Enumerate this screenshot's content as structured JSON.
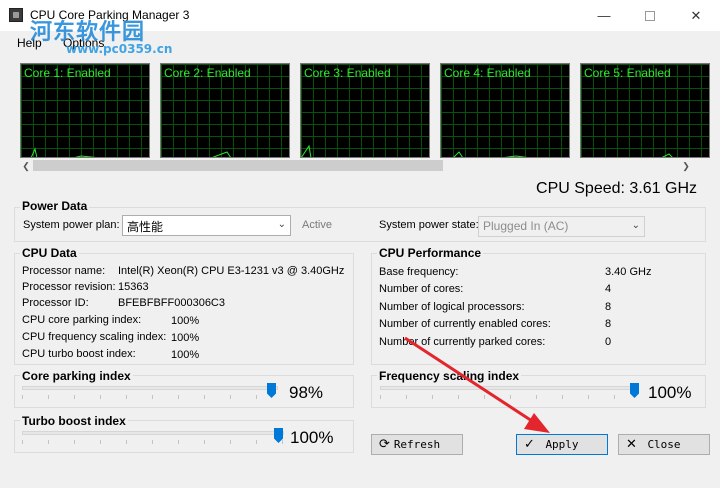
{
  "window": {
    "title": "CPU Core Parking Manager 3"
  },
  "watermark": {
    "text": "河东软件园",
    "url": "www.pc0359.cn"
  },
  "menu": {
    "help": "Help",
    "options": "Options"
  },
  "cores": [
    {
      "label": "Core 1: Enabled"
    },
    {
      "label": "Core 2: Enabled"
    },
    {
      "label": "Core 3: Enabled"
    },
    {
      "label": "Core 4: Enabled"
    },
    {
      "label": "Core 5: Enabled"
    }
  ],
  "cpu_speed": "CPU Speed: 3.61 GHz",
  "power_data": {
    "title": "Power Data",
    "plan_label": "System power plan:",
    "plan_value": "高性能",
    "plan_status": "Active",
    "state_label": "System power state:",
    "state_value": "Plugged In (AC)"
  },
  "cpu_data": {
    "title": "CPU Data",
    "rows": [
      {
        "label": "Processor name:",
        "value": "Intel(R) Xeon(R) CPU E3-1231 v3 @ 3.40GHz"
      },
      {
        "label": "Processor revision:",
        "value": "15363"
      },
      {
        "label": "Processor ID:",
        "value": "BFEBFBFF000306C3"
      },
      {
        "label": "CPU core parking index:",
        "value": "100%"
      },
      {
        "label": "CPU frequency scaling index:",
        "value": "100%"
      },
      {
        "label": "CPU turbo boost index:",
        "value": "100%"
      }
    ]
  },
  "cpu_performance": {
    "title": "CPU Performance",
    "rows": [
      {
        "label": "Base frequency:",
        "value": "3.40 GHz"
      },
      {
        "label": "Number of cores:",
        "value": "4"
      },
      {
        "label": "Number of logical processors:",
        "value": "8"
      },
      {
        "label": "Number of currently enabled cores:",
        "value": "8"
      },
      {
        "label": "Number of currently parked cores:",
        "value": "0"
      }
    ]
  },
  "sliders": {
    "core_parking": {
      "title": "Core parking index",
      "value_text": "98%",
      "value": 0.98
    },
    "frequency_scaling": {
      "title": "Frequency scaling index",
      "value_text": "100%",
      "value": 1.0
    },
    "turbo_boost": {
      "title": "Turbo boost index",
      "value_text": "100%",
      "value": 1.0
    }
  },
  "buttons": {
    "refresh": "Refresh",
    "apply": "Apply",
    "close": "Close"
  },
  "colors": {
    "graph_green": "#2ee62e",
    "accent": "#0078d7",
    "annotation_red": "#e3262d"
  }
}
